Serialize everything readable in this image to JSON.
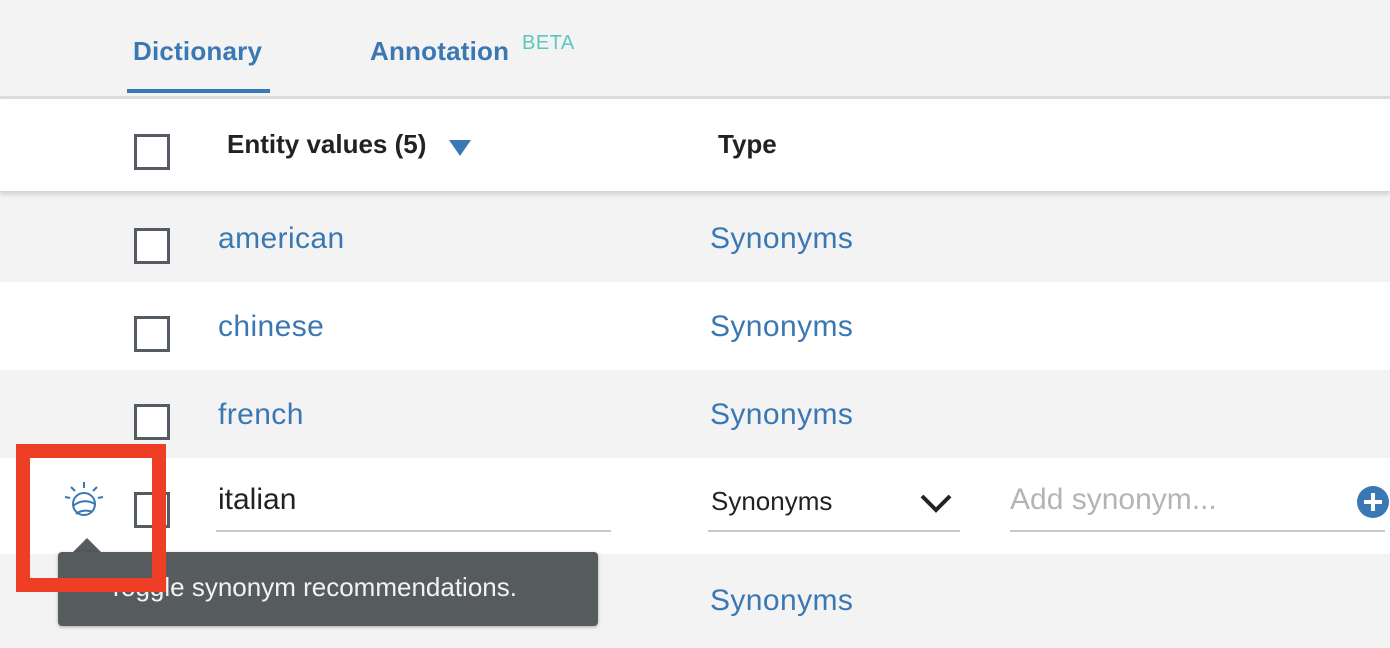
{
  "tabs": [
    {
      "label": "Dictionary",
      "active": true
    },
    {
      "label": "Annotation",
      "badge": "BETA",
      "active": false
    }
  ],
  "table": {
    "header": {
      "entity_values": "Entity values (5)",
      "type": "Type",
      "sort_icon": "sort-descending-triangle"
    },
    "rows": [
      {
        "value": "american",
        "type": "Synonyms"
      },
      {
        "value": "chinese",
        "type": "Synonyms"
      },
      {
        "value": "french",
        "type": "Synonyms"
      },
      {
        "value": "italian",
        "type": "Synonyms",
        "editing": true,
        "synonym_placeholder": "Add synonym..."
      },
      {
        "value": "",
        "type": "Synonyms"
      }
    ]
  },
  "tooltip": {
    "text": "Toggle synonym recommendations."
  },
  "icons": {
    "recommendation": "lightbulb-recommendation-icon",
    "add": "plus-circle-icon",
    "dropdown": "chevron-down-icon"
  },
  "colors": {
    "accent": "#3a78b4",
    "beta": "#5bc7bf",
    "highlight": "#ee3e26",
    "tooltip_bg": "#565b5d"
  }
}
